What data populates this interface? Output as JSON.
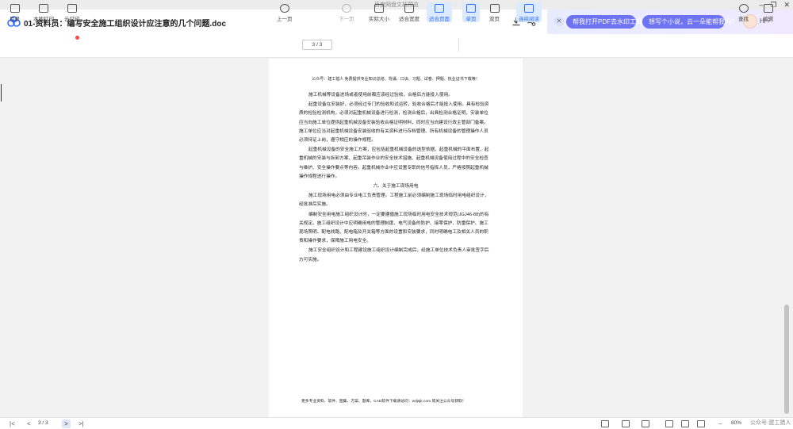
{
  "window": {
    "title": "百度网盘文档预览",
    "controls": [
      "minimize-icon",
      "restore-icon",
      "close-icon"
    ]
  },
  "doc": {
    "title": "01-资料员：编写安全施工组织设计应注意的几个问题.doc",
    "download_icon": "download-icon",
    "share_icon": "share-icon"
  },
  "ai_panel": {
    "suggestion_1": "帮我打开PDF去水印工具",
    "suggestion_2": "想写个小说，云一朵能帮我吗?",
    "greeting": "Hi",
    "accent_color": "#6d73f3"
  },
  "toolbar": {
    "catalog": "目录",
    "local_print": "本地打印",
    "cloud_print": "云打印",
    "prev_page": "上一页",
    "page_indicator": "3 / 3",
    "next_page": "下一页",
    "actual_size": "实际大小",
    "fit_width": "适合宽度",
    "fit_page": "适合页面",
    "single_page": "单页",
    "double_page": "双页",
    "continuous_read": "连续阅读",
    "search": "查找",
    "edit": "编辑",
    "active_color": "#2f6bff"
  },
  "page": {
    "header": "公众号：建工猎人 免费提供专业知识总结、背诵、口诀、习题、试卷、押题、执业证书下载等！",
    "paragraphs": [
      "施工机械等设备进场或者使用前都应该经过验收，合格后方能投入使用。",
      "起重设备在安装好，必须经过专门的验收和试运转，验收合格后才能投入使用。具有检验资质的检验检测机构，必须对起重机械设备进行检测，检测合格后，出具检测合格证明，安装单位应当向施工单位提供起重机械设备安装验收合格证明材料，同时应当向建设行政主管部门备案。施工单位应当对起重机械设备安装验收的有关资料进行存档管理。所有机械设备的管理操作人员必须持证上岗，遵守相应的操作规程。",
      "起重机械设备的安全施工方案，应包括起重机械设备的选型依据、起重机械的平面布置、起重机械的安装与拆卸方案、起重吊装作业的安全技术措施、起重机械设备使用过程中的安全检查与维护、安全操作要点等内容。起重机械作业中应设置专职的信号指挥人员，严格按照起重机械操作规程进行操作。",
      "六、关于施工现场用电",
      "施工现场用电必须由专业电工负责管理。工程施工前必须编制施工现场临时用电组织设计，经批准后实施。",
      "编制安全用电施工组织设计时，一定要遵循施工现场临时用电安全技术规范(JGJ46-88)的有关规定。施工组织设计中应明确用电的管理制度、电气设备的防护、接零保护、防雷保护、施工现场照明、配电线路、配电箱及开关箱等方面的设置和安装要求，同时明确电工及相关人员的职责和操作要求，保障施工用电安全。",
      "施工安全组织设计和工程建设施工组织设计编制完成后，经施工单位技术负责人审批签字后方可实施。"
    ],
    "footer": "更多专业资料、软件、图集、方案、题库、CAD软件下载请访问：wdjsjk.com 或关注公众号获取！"
  },
  "statusbar": {
    "first": "|<",
    "prev": "<",
    "page": "3 / 3",
    "next": ">",
    "last": ">|",
    "zoom": "80%",
    "watermark": "公众号·建工猎人"
  }
}
